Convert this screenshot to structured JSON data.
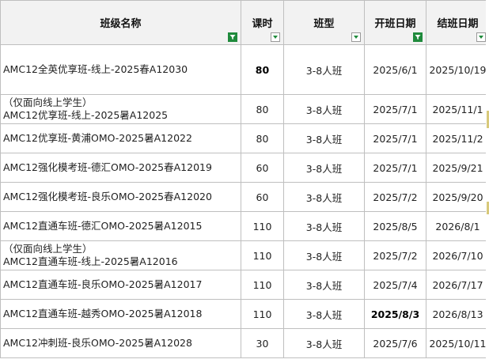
{
  "columns": [
    {
      "label": "班级名称",
      "filter": "filter-active"
    },
    {
      "label": "课时",
      "filter": "dropdown"
    },
    {
      "label": "班型",
      "filter": "dropdown"
    },
    {
      "label": "开班日期",
      "filter": "filter-active"
    },
    {
      "label": "结班日期",
      "filter": "dropdown"
    }
  ],
  "rows": [
    {
      "note": "",
      "name": "AMC12全英优享班-线上-2025春A12030",
      "hours": "80",
      "type": "3-8人班",
      "start": "2025/6/1",
      "end": "2025/10/19"
    },
    {
      "note": "（仅面向线上学生）",
      "name": "AMC12优享班-线上-2025暑A12025",
      "hours": "80",
      "type": "3-8人班",
      "start": "2025/7/1",
      "end": "2025/11/1"
    },
    {
      "note": "",
      "name": "AMC12优享班-黄浦OMO-2025暑A12022",
      "hours": "80",
      "type": "3-8人班",
      "start": "2025/7/1",
      "end": "2025/11/2"
    },
    {
      "note": "",
      "name": "AMC12强化模考班-德汇OMO-2025春A12019",
      "hours": "60",
      "type": "3-8人班",
      "start": "2025/7/1",
      "end": "2025/9/21"
    },
    {
      "note": "",
      "name": "AMC12强化模考班-良乐OMO-2025春A12020",
      "hours": "60",
      "type": "3-8人班",
      "start": "2025/7/2",
      "end": "2025/9/20"
    },
    {
      "note": "",
      "name": "AMC12直通车班-德汇OMO-2025暑A12015",
      "hours": "110",
      "type": "3-8人班",
      "start": "2025/8/5",
      "end": "2026/8/1"
    },
    {
      "note": "（仅面向线上学生）",
      "name": "AMC12直通车班-线上-2025暑A12016",
      "hours": "110",
      "type": "3-8人班",
      "start": "2025/7/2",
      "end": "2026/7/10"
    },
    {
      "note": "",
      "name": "AMC12直通车班-良乐OMO-2025暑A12017",
      "hours": "110",
      "type": "3-8人班",
      "start": "2025/7/4",
      "end": "2026/7/17"
    },
    {
      "note": "",
      "name": "AMC12直通车班-越秀OMO-2025暑A12018",
      "hours": "110",
      "type": "3-8人班",
      "start": "2025/8/3",
      "end": "2026/8/13"
    },
    {
      "note": "",
      "name": "AMC12冲刺班-良乐OMO-2025暑A12028",
      "hours": "30",
      "type": "3-8人班",
      "start": "2025/7/6",
      "end": "2025/10/11"
    }
  ],
  "colors": {
    "header_bg": "#f2f2f2",
    "grid": "#bfbfbf",
    "filter_active": "#1f8a3c"
  }
}
